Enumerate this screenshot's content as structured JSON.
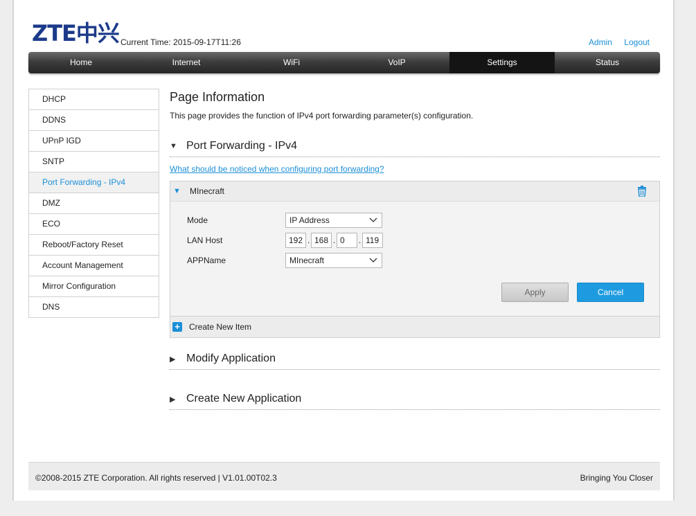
{
  "header": {
    "logo_text": "ZTE中兴",
    "current_time_label": "Current Time: 2015-09-17T11:26",
    "links": {
      "admin": "Admin",
      "logout": "Logout"
    }
  },
  "nav": {
    "items": [
      "Home",
      "Internet",
      "WiFi",
      "VoIP",
      "Settings",
      "Status"
    ],
    "active": "Settings"
  },
  "sidebar": {
    "items": [
      "DHCP",
      "DDNS",
      "UPnP IGD",
      "SNTP",
      "Port Forwarding - IPv4",
      "DMZ",
      "ECO",
      "Reboot/Factory Reset",
      "Account Management",
      "Mirror Configuration",
      "DNS"
    ],
    "active": "Port Forwarding - IPv4"
  },
  "page": {
    "title": "Page Information",
    "description": "This page provides the function of IPv4 port forwarding parameter(s) configuration."
  },
  "port_forwarding": {
    "section_title": "Port Forwarding - IPv4",
    "notice_link": "What should be noticed when configuring port forwarding?",
    "entry": {
      "name": "MInecraft",
      "mode_label": "Mode",
      "mode_value": "IP Address",
      "lan_host_label": "LAN Host",
      "lan_host": [
        "192",
        "168",
        "0",
        "119"
      ],
      "appname_label": "APPName",
      "appname_value": "MInecraft"
    },
    "apply_label": "Apply",
    "cancel_label": "Cancel",
    "create_item_label": "Create New Item"
  },
  "sections": {
    "modify_application": "Modify Application",
    "create_new_application": "Create New Application"
  },
  "footer": {
    "copyright": "©2008-2015 ZTE Corporation. All rights reserved  |   V1.01.00T02.3",
    "slogan": "Bringing You Closer"
  },
  "colors": {
    "accent": "#1c8fd8",
    "nav_active": "#141414",
    "cancel_button": "#1e9be0"
  }
}
